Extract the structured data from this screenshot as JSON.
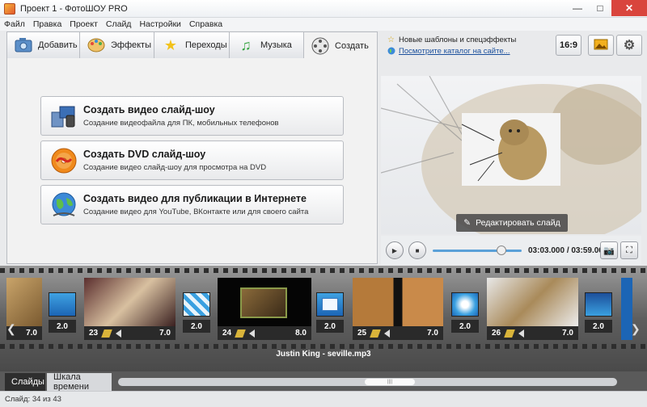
{
  "window": {
    "title": "Проект 1 - ФотоШОУ PRO",
    "controls": [
      "—",
      "□",
      "✕"
    ]
  },
  "menu": [
    "Файл",
    "Правка",
    "Проект",
    "Слайд",
    "Настройки",
    "Справка"
  ],
  "tabs": [
    {
      "label": "Добавить",
      "icon": "add-photo-icon"
    },
    {
      "label": "Эффекты",
      "icon": "effects-palette-icon"
    },
    {
      "label": "Переходы",
      "icon": "star-icon"
    },
    {
      "label": "Музыка",
      "icon": "music-note-icon"
    },
    {
      "label": "Создать",
      "icon": "film-reel-icon",
      "active": true
    }
  ],
  "create_options": [
    {
      "title": "Создать видео слайд-шоу",
      "description": "Создание видеофайла для ПК, мобильных телефонов",
      "icon": "video-devices-icon"
    },
    {
      "title": "Создать DVD слайд-шоу",
      "description": "Создание видео слайд-шоу для просмотра на DVD",
      "icon": "dvd-disc-icon"
    },
    {
      "title": "Создать видео для публикации в Интернете",
      "description": "Создание видео для YouTube, ВКонтакте или для своего сайта",
      "icon": "globe-icon"
    }
  ],
  "news": {
    "line1": "Новые шаблоны и спецэффекты",
    "line2": "Посмотрите каталог на сайте..."
  },
  "top_buttons": {
    "aspect": "16:9"
  },
  "preview": {
    "edit_label": "Редактировать слайд"
  },
  "player": {
    "time": "03:03.000 / 03:59.000",
    "progress": 0.77
  },
  "timeline": {
    "slides": [
      {
        "number": "",
        "duration": "7.0"
      },
      {
        "number": "23",
        "duration": "7.0"
      },
      {
        "number": "24",
        "duration": "8.0"
      },
      {
        "number": "25",
        "duration": "7.0"
      },
      {
        "number": "26",
        "duration": "7.0"
      }
    ],
    "transitions": [
      "2.0",
      "2.0",
      "2.0",
      "2.0",
      "2.0"
    ],
    "audio": "Justin King - seville.mp3"
  },
  "bottom_tabs": [
    "Слайды",
    "Шкала времени"
  ],
  "status": "Слайд: 34 из 43",
  "colors": {
    "link": "#1a4f9c",
    "accent": "#5aa0d8",
    "close": "#d9453d"
  }
}
